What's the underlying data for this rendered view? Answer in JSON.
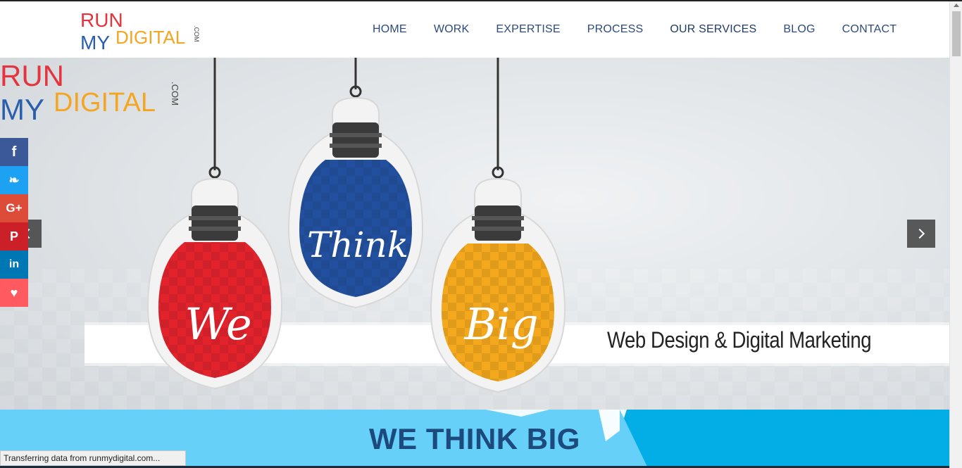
{
  "brand": {
    "logo_line1": "RUN",
    "logo_line2a": "MY",
    "logo_line2b": "DIGITAL",
    "logo_suffix": ".COM",
    "colors": {
      "red": "#e5343d",
      "blue": "#2a5fae",
      "orange": "#f4a623"
    }
  },
  "nav": {
    "items": [
      {
        "label": "HOME"
      },
      {
        "label": "WORK"
      },
      {
        "label": "EXPERTISE"
      },
      {
        "label": "PROCESS"
      },
      {
        "label": "OUR SERVICES"
      },
      {
        "label": "BLOG"
      },
      {
        "label": "CONTACT"
      }
    ]
  },
  "hero": {
    "bulbs": [
      {
        "word": "We",
        "color": "#e2232c"
      },
      {
        "word": "Think",
        "color": "#23509e"
      },
      {
        "word": "Big",
        "color": "#f3a81d"
      }
    ],
    "tagline": "Web Design & Digital Marketing",
    "prev_icon": "chevron-left-icon",
    "next_icon": "chevron-right-icon"
  },
  "social": {
    "items": [
      {
        "name": "facebook",
        "glyph": "f"
      },
      {
        "name": "twitter",
        "glyph": "❧"
      },
      {
        "name": "google-plus",
        "glyph": "G+"
      },
      {
        "name": "pinterest",
        "glyph": "P"
      },
      {
        "name": "linkedin",
        "glyph": "in"
      },
      {
        "name": "love",
        "glyph": "♥"
      }
    ]
  },
  "banner": {
    "title": "WE THINK BIG"
  },
  "status_bar": {
    "text": "Transferring data from runmydigital.com..."
  }
}
